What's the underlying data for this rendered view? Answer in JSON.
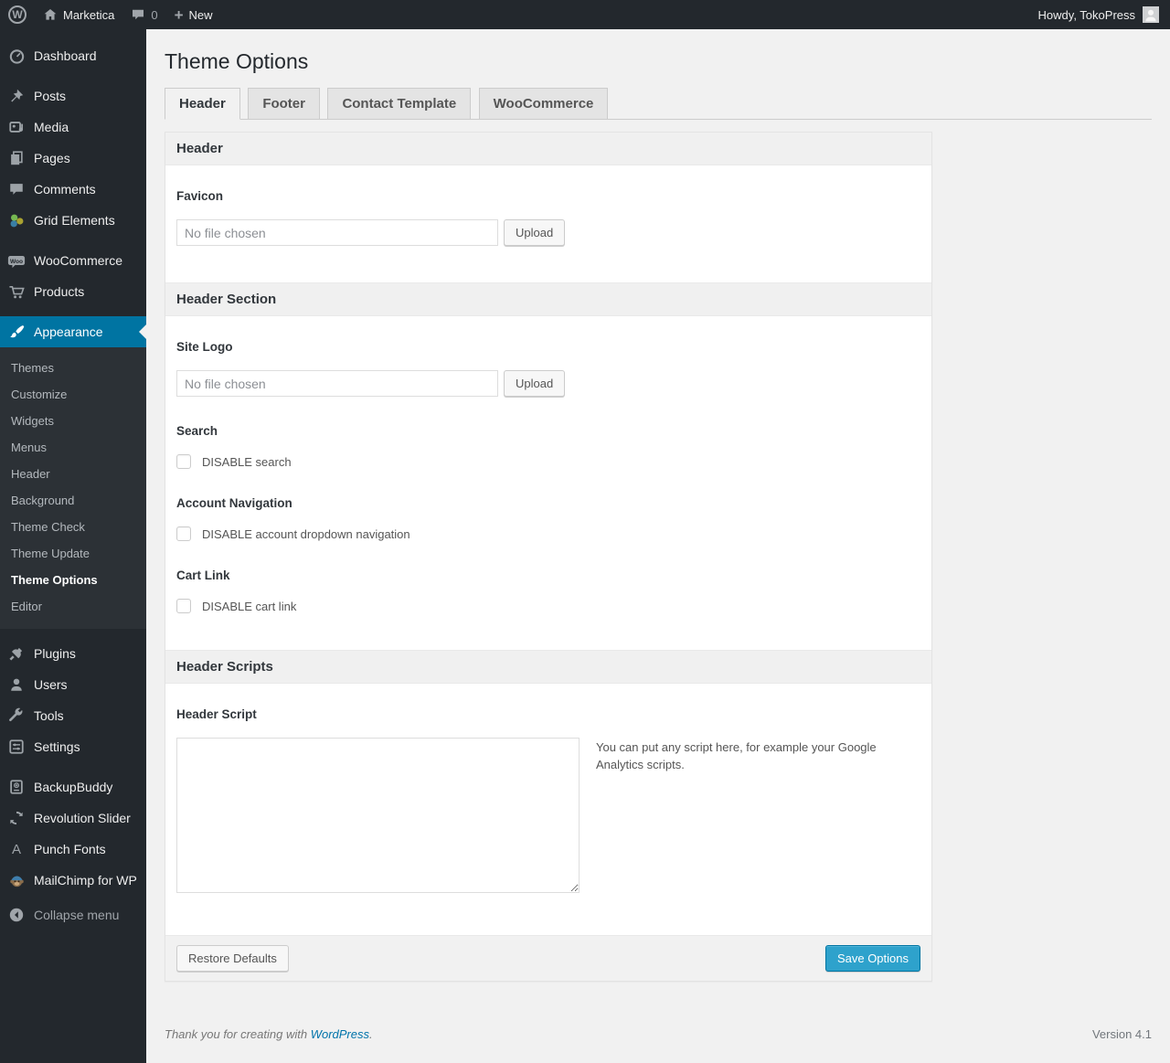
{
  "admin_bar": {
    "wp_logo": "W",
    "site_name": "Marketica",
    "comments_count": "0",
    "new_label": "New",
    "howdy": "Howdy, TokoPress"
  },
  "sidebar": {
    "top_items": [
      {
        "label": "Dashboard",
        "icon": "dashboard-icon"
      },
      {
        "label": "Posts",
        "icon": "pushpin-icon"
      },
      {
        "label": "Media",
        "icon": "media-icon"
      },
      {
        "label": "Pages",
        "icon": "pages-icon"
      },
      {
        "label": "Comments",
        "icon": "comment-icon"
      },
      {
        "label": "Grid Elements",
        "icon": "grid-elements-icon"
      },
      {
        "label": "WooCommerce",
        "icon": "woo-badge-icon"
      },
      {
        "label": "Products",
        "icon": "cart-icon"
      }
    ],
    "appearance": {
      "label": "Appearance",
      "icon": "brush-icon"
    },
    "appearance_submenu": [
      "Themes",
      "Customize",
      "Widgets",
      "Menus",
      "Header",
      "Background",
      "Theme Check",
      "Theme Update",
      "Theme Options",
      "Editor"
    ],
    "current_submenu_item": "Theme Options",
    "bottom_items": [
      {
        "label": "Plugins",
        "icon": "plug-icon"
      },
      {
        "label": "Users",
        "icon": "user-icon"
      },
      {
        "label": "Tools",
        "icon": "wrench-icon"
      },
      {
        "label": "Settings",
        "icon": "settings-icon"
      },
      {
        "label": "BackupBuddy",
        "icon": "backup-drive-icon"
      },
      {
        "label": "Revolution Slider",
        "icon": "refresh-icon"
      },
      {
        "label": "Punch Fonts",
        "icon": "letter-a-icon"
      },
      {
        "label": "MailChimp for WP",
        "icon": "monkey-icon"
      }
    ],
    "collapse_label": "Collapse menu"
  },
  "page": {
    "title": "Theme Options",
    "tabs": [
      {
        "label": "Header",
        "active": true
      },
      {
        "label": "Footer",
        "active": false
      },
      {
        "label": "Contact Template",
        "active": false
      },
      {
        "label": "WooCommerce",
        "active": false
      }
    ]
  },
  "panel": {
    "section1_title": "Header",
    "favicon_label": "Favicon",
    "favicon_value": "No file chosen",
    "favicon_upload": "Upload",
    "section2_title": "Header Section",
    "site_logo_label": "Site Logo",
    "site_logo_value": "No file chosen",
    "site_logo_upload": "Upload",
    "search_label": "Search",
    "search_checkbox_label": "DISABLE search",
    "account_nav_label": "Account Navigation",
    "account_nav_checkbox_label": "DISABLE account dropdown navigation",
    "cart_link_label": "Cart Link",
    "cart_link_checkbox_label": "DISABLE cart link",
    "section3_title": "Header Scripts",
    "header_script_label": "Header Script",
    "header_script_value": "",
    "header_script_hint": "You can put any script here, for example your Google Analytics scripts.",
    "restore_defaults_label": "Restore Defaults",
    "save_options_label": "Save Options"
  },
  "footer": {
    "thanks_prefix": "Thank you for creating with ",
    "wordpress_link": "WordPress",
    "thanks_suffix": ".",
    "version": "Version 4.1"
  },
  "colors": {
    "admin_bar_bg": "#23282d",
    "sidebar_bg": "#23282d",
    "active_menu_blue": "#0074a2",
    "primary_button_blue": "#2ea2cc",
    "link_blue": "#0073aa",
    "page_bg": "#f1f1f1"
  }
}
